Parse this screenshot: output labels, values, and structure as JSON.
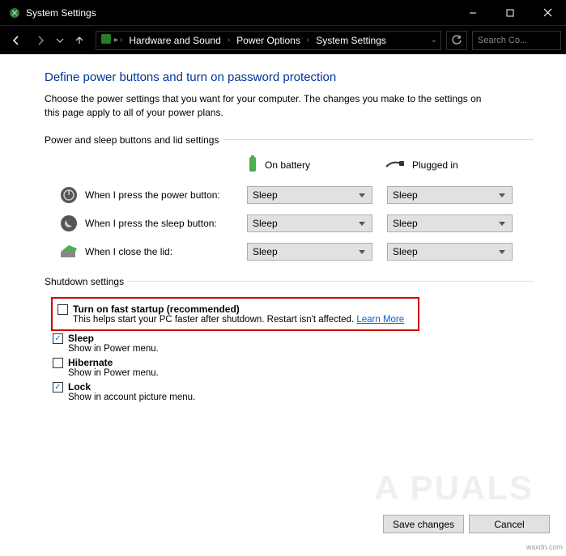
{
  "window": {
    "title": "System Settings"
  },
  "breadcrumb": {
    "a": "Hardware and Sound",
    "b": "Power Options",
    "c": "System Settings"
  },
  "search": {
    "placeholder": "Search Co..."
  },
  "page": {
    "heading": "Define power buttons and turn on password protection",
    "desc": "Choose the power settings that you want for your computer. The changes you make to the settings on this page apply to all of your power plans."
  },
  "section1": {
    "label": "Power and sleep buttons and lid settings",
    "col_battery": "On battery",
    "col_plugged": "Plugged in",
    "rows": {
      "power": {
        "label": "When I press the power button:",
        "battery": "Sleep",
        "plugged": "Sleep"
      },
      "sleep": {
        "label": "When I press the sleep button:",
        "battery": "Sleep",
        "plugged": "Sleep"
      },
      "lid": {
        "label": "When I close the lid:",
        "battery": "Sleep",
        "plugged": "Sleep"
      }
    }
  },
  "section2": {
    "label": "Shutdown settings",
    "fast_startup": {
      "label": "Turn on fast startup (recommended)",
      "desc": "This helps start your PC faster after shutdown. Restart isn't affected. ",
      "learn": "Learn More"
    },
    "sleep": {
      "label": "Sleep",
      "desc": "Show in Power menu."
    },
    "hibernate": {
      "label": "Hibernate",
      "desc": "Show in Power menu."
    },
    "lock": {
      "label": "Lock",
      "desc": "Show in account picture menu."
    }
  },
  "buttons": {
    "save": "Save changes",
    "cancel": "Cancel"
  },
  "watermark": "A   PUALS",
  "credit": "wsxdn.com"
}
